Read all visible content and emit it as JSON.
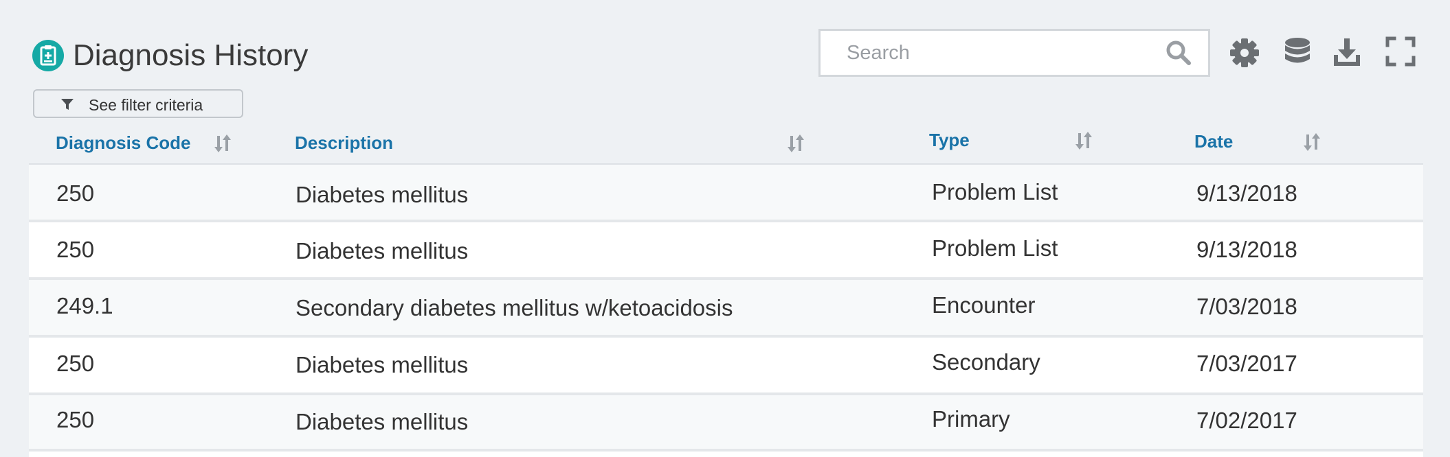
{
  "header": {
    "title": "Diagnosis History",
    "filter_label": "See filter criteria"
  },
  "search": {
    "placeholder": "Search",
    "value": ""
  },
  "toolbar": {
    "icons": [
      "settings-icon",
      "database-icon",
      "download-icon",
      "fullscreen-icon"
    ]
  },
  "table": {
    "columns": [
      "Diagnosis Code",
      "Description",
      "Type",
      "Date"
    ],
    "rows": [
      {
        "code": "250",
        "description": "Diabetes mellitus",
        "type": "Problem List",
        "date": "9/13/2018"
      },
      {
        "code": "250",
        "description": "Diabetes mellitus",
        "type": "Problem List",
        "date": "9/13/2018"
      },
      {
        "code": "249.1",
        "description": "Secondary diabetes mellitus w/ketoacidosis",
        "type": "Encounter",
        "date": "7/03/2018"
      },
      {
        "code": "250",
        "description": "Diabetes mellitus",
        "type": "Secondary",
        "date": "7/03/2017"
      },
      {
        "code": "250",
        "description": "Diabetes mellitus",
        "type": "Primary",
        "date": "7/02/2017"
      }
    ]
  },
  "colors": {
    "accent_teal": "#15a9a5",
    "header_blue": "#1a73a8",
    "icon_gray": "#6b6f73",
    "background": "#eef1f4"
  }
}
